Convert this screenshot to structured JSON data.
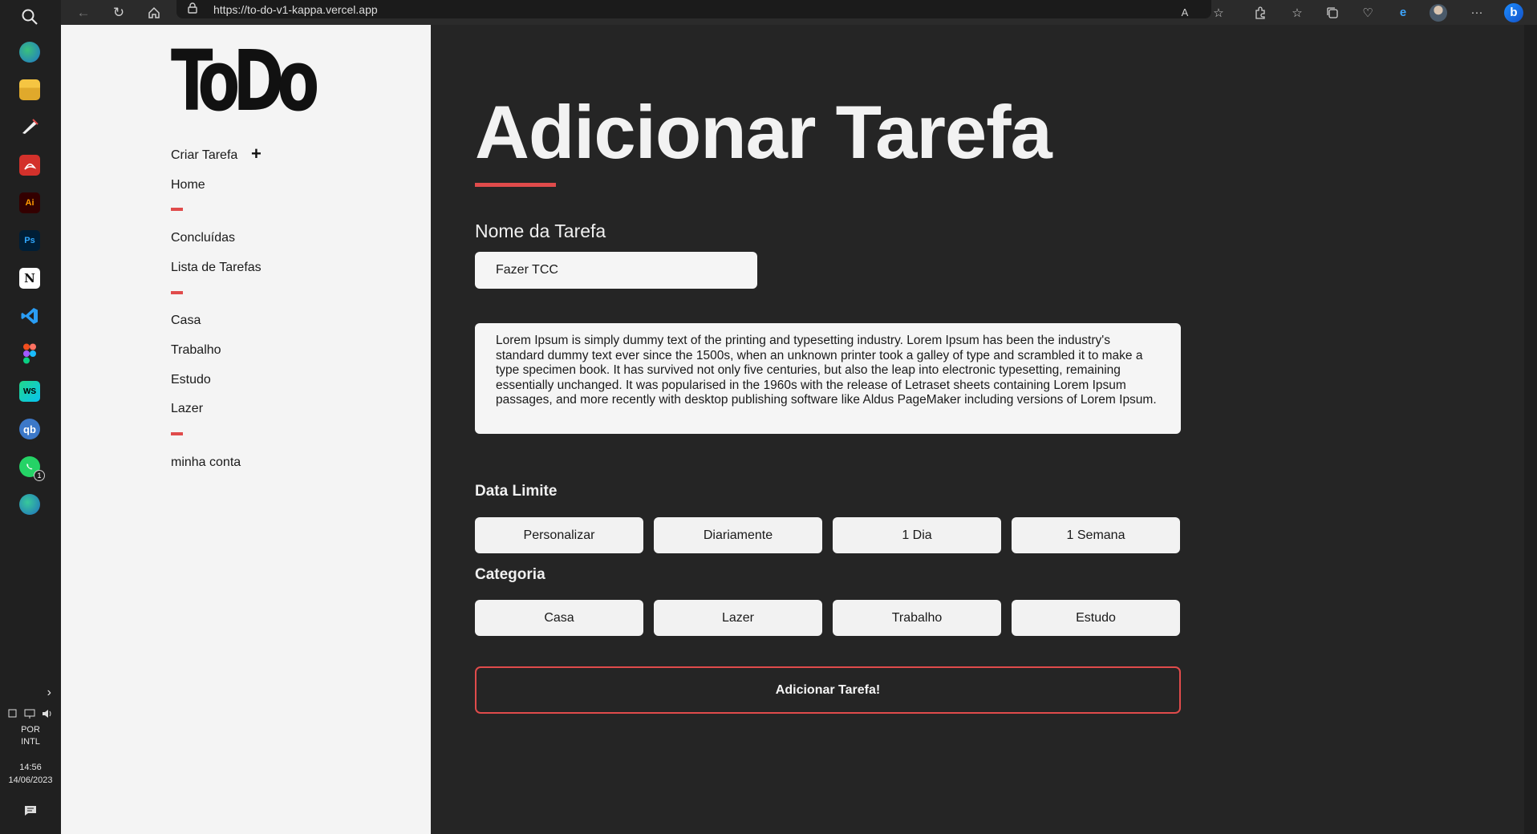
{
  "taskbar": {
    "icons": [
      "search-icon",
      "edge-icon",
      "file-explorer-icon",
      "inkscape-icon",
      "acrobat-icon",
      "illustrator-icon",
      "photoshop-icon",
      "notion-icon",
      "vscode-icon",
      "figma-icon",
      "webstorm-icon",
      "qbittorrent-icon",
      "whatsapp-icon",
      "edge-dev-icon"
    ],
    "illustrator_label": "Ai",
    "photoshop_label": "Ps",
    "notion_label": "N",
    "webstorm_label": "WS",
    "qbittorrent_label": "qb",
    "whatsapp_badge": "1",
    "language": "POR",
    "layout": "INTL",
    "time": "14:56",
    "date": "14/06/2023"
  },
  "browser": {
    "url": "https://to-do-v1-kappa.vercel.app",
    "read_aloud_label": "A"
  },
  "sidebar": {
    "logo": "ToDo",
    "create_task": "Criar Tarefa",
    "items": {
      "home": "Home",
      "completed": "Concluídas",
      "task_list": "Lista de Tarefas",
      "casa": "Casa",
      "trabalho": "Trabalho",
      "estudo": "Estudo",
      "lazer": "Lazer",
      "account": "minha conta"
    },
    "accent_color": "#e04b4b"
  },
  "main": {
    "title": "Adicionar Tarefa",
    "task_name_label": "Nome da Tarefa",
    "task_name_value": "Fazer TCC",
    "description": "Lorem Ipsum is simply dummy text of the printing and typesetting industry. Lorem Ipsum has been the industry's standard dummy text ever since the 1500s, when an unknown printer took a galley of type and scrambled it to make a type specimen book. It has survived not only five centuries, but also the leap into electronic typesetting, remaining essentially unchanged. It was popularised in the 1960s with the release of Letraset sheets containing Lorem Ipsum passages, and more recently with desktop publishing software like Aldus PageMaker including versions of Lorem Ipsum.",
    "deadline_label": "Data Limite",
    "deadline_options": [
      "Personalizar",
      "Diariamente",
      "1 Dia",
      "1 Semana"
    ],
    "category_label": "Categoria",
    "category_options": [
      "Casa",
      "Lazer",
      "Trabalho",
      "Estudo"
    ],
    "submit_label": "Adicionar Tarefa!"
  }
}
